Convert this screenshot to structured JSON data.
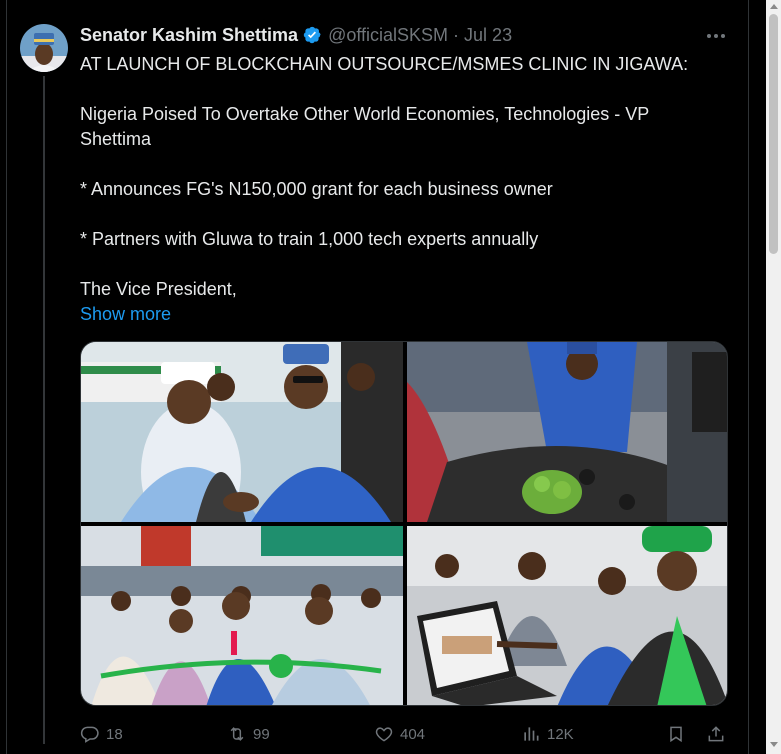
{
  "tweet": {
    "author_name": "Senator Kashim Shettima",
    "handle": "@officialSKSM",
    "separator": "·",
    "date": "Jul 23",
    "lines": [
      "AT LAUNCH OF BLOCKCHAIN OUTSOURCE/MSMES CLINIC IN JIGAWA:",
      "Nigeria Poised To Overtake Other World Economies, Technologies - VP Shettima",
      "* Announces FG's N150,000 grant for each business owner",
      "* Partners with Gluwa to train 1,000 tech experts annually",
      "The Vice President,"
    ],
    "show_more": "Show more",
    "accent_color": "#1d9bf0",
    "icons": {
      "verified": "verified-badge-icon",
      "more": "more-options-icon",
      "reply": "reply-icon",
      "retweet": "retweet-icon",
      "like": "like-icon",
      "views": "views-icon",
      "bookmark": "bookmark-icon",
      "share": "share-icon"
    }
  },
  "actions": {
    "replies": "18",
    "retweets": "99",
    "likes": "404",
    "views": "12K"
  }
}
